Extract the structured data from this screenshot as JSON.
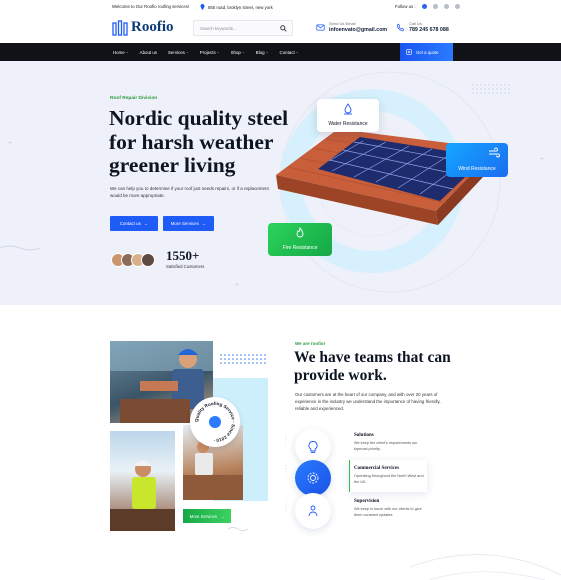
{
  "topbar": {
    "welcome": "Welcome to Our Roofio roofing services!",
    "address": "855 road, broklyn street, new york",
    "follow_label": "Follow us :"
  },
  "header": {
    "logo_text": "Roofio",
    "search_placeholder": "Search keywords...",
    "email_label": "Send Us Email",
    "email_value": "infoenvato@gmail.com",
    "call_label": "Call Us",
    "call_value": "789 245 678 088"
  },
  "nav": {
    "items": [
      {
        "label": "Home"
      },
      {
        "label": "About us"
      },
      {
        "label": "Services"
      },
      {
        "label": "Projects"
      },
      {
        "label": "Shop"
      },
      {
        "label": "Blog"
      },
      {
        "label": "Contact"
      }
    ],
    "cta": "Get a quote"
  },
  "hero": {
    "kicker": "Roof Repair Division",
    "title": "Nordic quality steel for harsh weather greener living",
    "description": "We can help you to determine if your roof just needs repairs, or if a replacement would be more appropriate.",
    "btn_contact": "Contact us",
    "btn_services": "More Services",
    "customer_count": "1550+",
    "customer_label": "Satisfied Customers",
    "features": {
      "water": "Water Resistance",
      "wind": "Wind Resistance",
      "fire": "Fire Resistance"
    }
  },
  "about": {
    "kicker": "We are roofio!",
    "title": "We have teams that can provide work.",
    "description": "Our customers are at the heart of our company, and with over 20 years of experience in the industry we understand the importance of having friendly, reliable and experienced.",
    "badge_text": "Quality Roofing Service · Since 2010 ·",
    "more_button": "More Services",
    "services": [
      {
        "title": "Solutions",
        "desc": "We keep the client's requirements our topmost priority."
      },
      {
        "title": "Commercial Services",
        "desc": "Operating throughout the North West and the UK."
      },
      {
        "title": "Supervision",
        "desc": "We keep in touch with our clients to give them constant updates."
      }
    ]
  },
  "colors": {
    "brand_blue": "#1f5bf5",
    "accent_green": "#2a9c3e",
    "nav_dark": "#101217"
  }
}
